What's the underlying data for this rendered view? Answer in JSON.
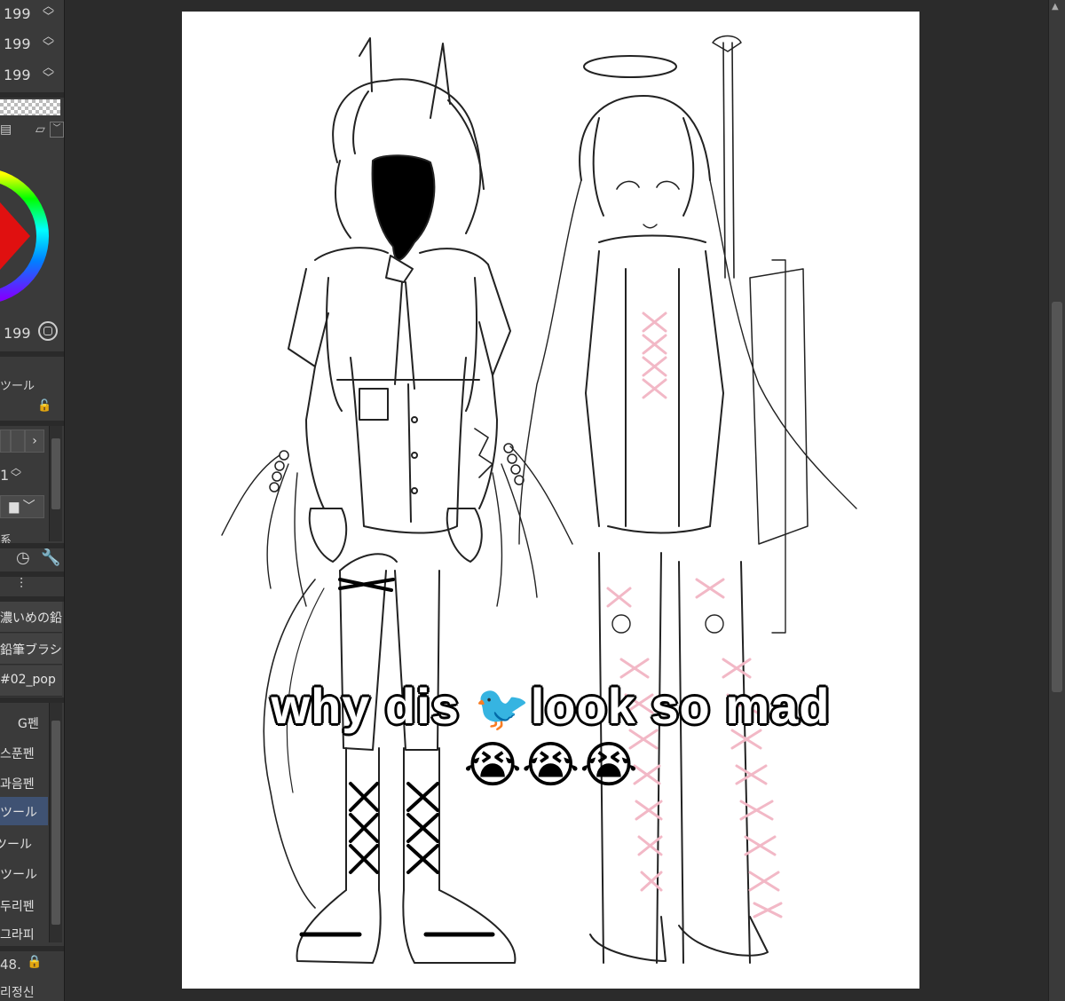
{
  "left_panel": {
    "slider_values": [
      "199",
      "199",
      "199"
    ],
    "color_value": "199",
    "layer_tool_label": "ツール",
    "layer_opacity": "1",
    "subtool_partial_label": "系",
    "brushes": [
      "濃いめの鉛",
      "鉛筆ブラシ",
      "#02_pop"
    ],
    "tools": [
      "G펜",
      "스푼펜",
      "과음펜",
      "ツール",
      "ツール",
      "ツール",
      "두리펜",
      "그라피"
    ],
    "active_tool_index": 3,
    "bottom_value": "48.",
    "bottom_label": "리정신"
  },
  "caption": {
    "line1_before": "why dis ",
    "bird_emoji": "🐦",
    "line1_after": "look so mad",
    "line2": "😭😭😭"
  },
  "colors": {
    "app_background": "#2b2b2b",
    "panel_background": "#3a3a3a",
    "active_tool": "#3f5273",
    "canvas": "#ffffff",
    "lacing_pink": "#f2b8c6",
    "lacing_black": "#000000"
  }
}
